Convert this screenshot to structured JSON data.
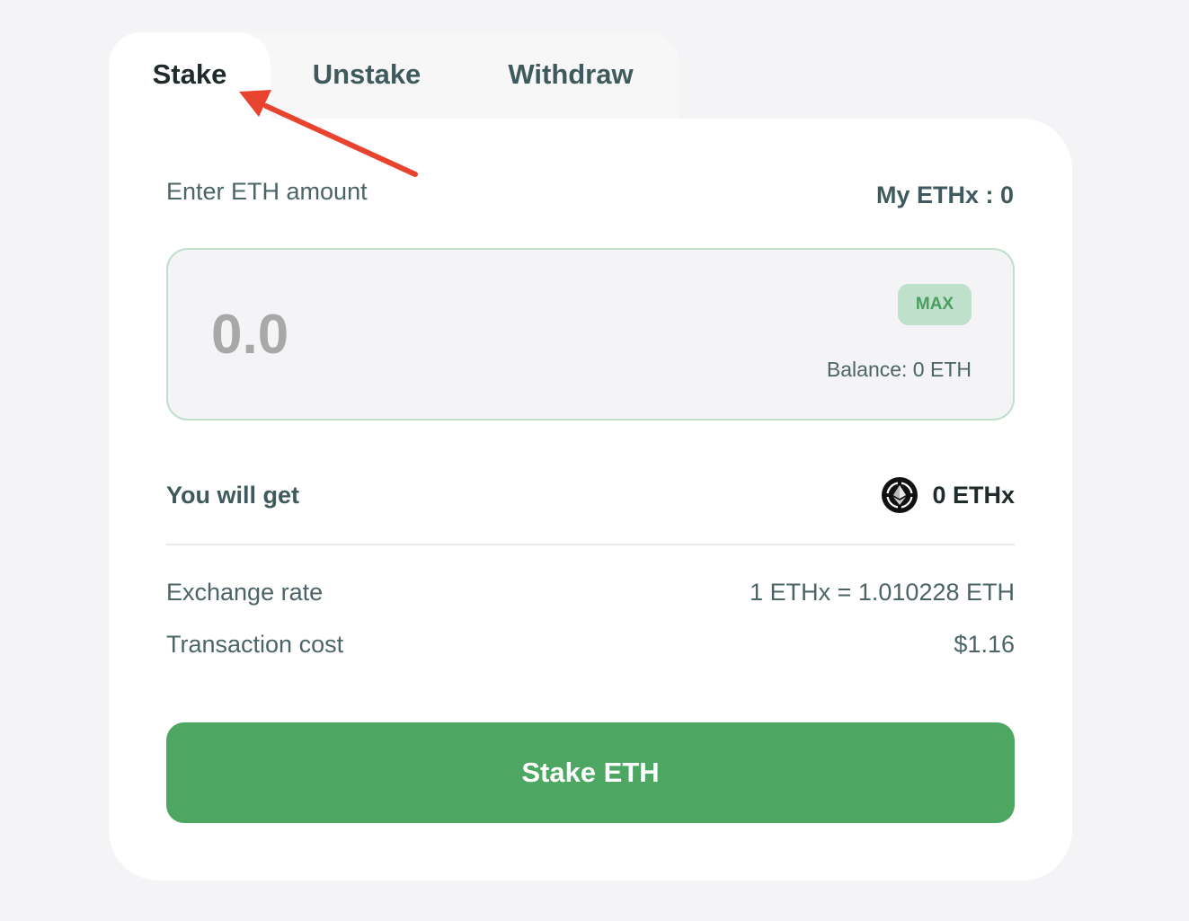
{
  "tabs": [
    {
      "label": "Stake",
      "active": true
    },
    {
      "label": "Unstake",
      "active": false
    },
    {
      "label": "Withdraw",
      "active": false
    }
  ],
  "form": {
    "enter_label": "Enter ETH amount",
    "my_balance": "My ETHx : 0",
    "amount_placeholder": "0.0",
    "amount_value": "",
    "max_label": "MAX",
    "balance_text": "Balance: 0 ETH"
  },
  "summary": {
    "get_label": "You will get",
    "get_value": "0 ETHx",
    "get_icon": "ethx-token-icon",
    "rows": [
      {
        "label": "Exchange rate",
        "value": "1 ETHx = 1.010228 ETH"
      },
      {
        "label": "Transaction cost",
        "value": "$1.16"
      }
    ]
  },
  "action": {
    "stake_label": "Stake ETH"
  },
  "colors": {
    "accent": "#4da661",
    "accent_light": "#bfe0cb",
    "annotation_arrow": "#e8432f"
  },
  "annotation": {
    "type": "arrow",
    "points_to": "tab-stake"
  }
}
